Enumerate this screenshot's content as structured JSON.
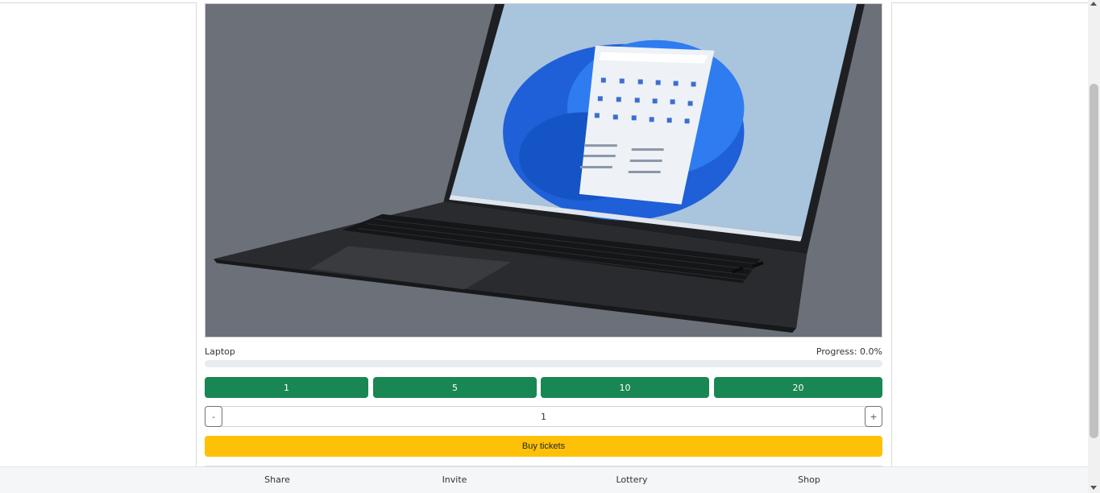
{
  "product": {
    "image_alt": "Laptop",
    "name": "Laptop",
    "progress_label": "Progress: 0.0%",
    "progress_fraction": 0.0
  },
  "quantity_options": [
    "1",
    "5",
    "10",
    "20"
  ],
  "stepper": {
    "minus": "-",
    "value": "1",
    "plus": "+"
  },
  "buy_label": "Buy tickets",
  "nav": {
    "share": "Share",
    "invite": "Invite",
    "lottery": "Lottery",
    "shop": "Shop"
  },
  "colors": {
    "success": "#198754",
    "warning": "#ffc107",
    "photo_bg": "#6b7079"
  }
}
